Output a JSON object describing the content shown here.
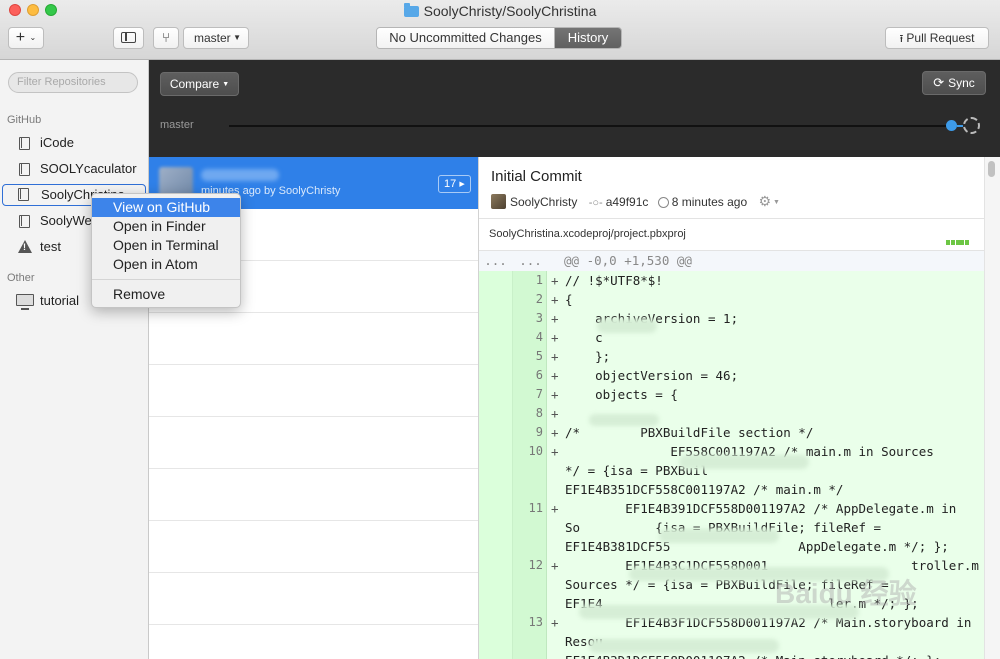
{
  "window": {
    "title": "SoolyChristy/SoolyChristina"
  },
  "toolbar": {
    "add_label": "+",
    "branch": "master",
    "tabs": [
      {
        "label": "No Uncommitted Changes",
        "active": false
      },
      {
        "label": "History",
        "active": true
      }
    ],
    "pull_request_label": "Pull Request"
  },
  "sidebar": {
    "filter_placeholder": "Filter Repositories",
    "sections": [
      {
        "title": "GitHub",
        "items": [
          {
            "label": "iCode",
            "icon": "repo-icon"
          },
          {
            "label": "SOOLYcaculator",
            "icon": "repo-icon"
          },
          {
            "label": "SoolyChristina",
            "icon": "repo-icon",
            "selected": true
          },
          {
            "label": "SoolyWe",
            "icon": "repo-icon"
          },
          {
            "label": "test",
            "icon": "warning-icon"
          }
        ]
      },
      {
        "title": "Other",
        "items": [
          {
            "label": "tutorial",
            "icon": "monitor-icon"
          }
        ]
      }
    ]
  },
  "context_menu": {
    "items": [
      {
        "label": "View on GitHub",
        "highlighted": true
      },
      {
        "label": "Open in Finder"
      },
      {
        "label": "Open in Terminal"
      },
      {
        "label": "Open in Atom"
      },
      {
        "label": "Remove",
        "separator_before": true
      }
    ]
  },
  "history": {
    "compare_label": "Compare",
    "sync_label": "Sync",
    "branch_label": "master"
  },
  "commits": [
    {
      "meta": "minutes ago by SoolyChristy",
      "badge": "17",
      "selected": true
    }
  ],
  "commit_detail": {
    "title": "Initial Commit",
    "author": "SoolyChristy",
    "sha": "a49f91c",
    "time": "8 minutes ago",
    "file": {
      "name": "SoolyChristina.xcodeproj/project.pbxproj"
    },
    "diff": {
      "hunk_gutter_a": "...",
      "hunk_gutter_b": "...",
      "hunk": "@@ -0,0 +1,530 @@",
      "lines": [
        {
          "num": "1",
          "prefix": "+",
          "code": "// !$*UTF8*$!"
        },
        {
          "num": "2",
          "prefix": "+",
          "code": "{"
        },
        {
          "num": "3",
          "prefix": "+",
          "code": "    archiveVersion = 1;"
        },
        {
          "num": "4",
          "prefix": "+",
          "code": "    c"
        },
        {
          "num": "5",
          "prefix": "+",
          "code": "    };"
        },
        {
          "num": "6",
          "prefix": "+",
          "code": "    objectVersion = 46;"
        },
        {
          "num": "7",
          "prefix": "+",
          "code": "    objects = {"
        },
        {
          "num": "8",
          "prefix": "+",
          "code": ""
        },
        {
          "num": "9",
          "prefix": "+",
          "code": "/*        PBXBuildFile section */"
        },
        {
          "num": "10",
          "prefix": "+",
          "code": "              EF558C001197A2 /* main.m in Sources"
        },
        {
          "num": "",
          "prefix": "",
          "code": "*/ = {isa = PBXBuil"
        },
        {
          "num": "",
          "prefix": "",
          "code": "EF1E4B351DCF558C001197A2 /* main.m */"
        },
        {
          "num": "11",
          "prefix": "+",
          "code": "        EF1E4B391DCF558D001197A2 /* AppDelegate.m in"
        },
        {
          "num": "",
          "prefix": "",
          "code": "So          {isa = PBXBuildFile; fileRef ="
        },
        {
          "num": "",
          "prefix": "",
          "code": "EF1E4B381DCF55                 AppDelegate.m */; };"
        },
        {
          "num": "12",
          "prefix": "+",
          "code": "        EF1E4B3C1DCF558D001                   troller.m in"
        },
        {
          "num": "",
          "prefix": "",
          "code": "Sources */ = {isa = PBXBuildFile; fileRef ="
        },
        {
          "num": "",
          "prefix": "",
          "code": "EF1E4                              ler.m */; };"
        },
        {
          "num": "13",
          "prefix": "+",
          "code": "        EF1E4B3F1DCF558D001197A2 /* Main.storyboard in"
        },
        {
          "num": "",
          "prefix": "",
          "code": "Resou"
        },
        {
          "num": "",
          "prefix": "",
          "code": "EF1E4B3D1DCF558D001197A2 /* Main.storyboard */; };"
        }
      ]
    }
  },
  "watermark": "Baidu 经验"
}
